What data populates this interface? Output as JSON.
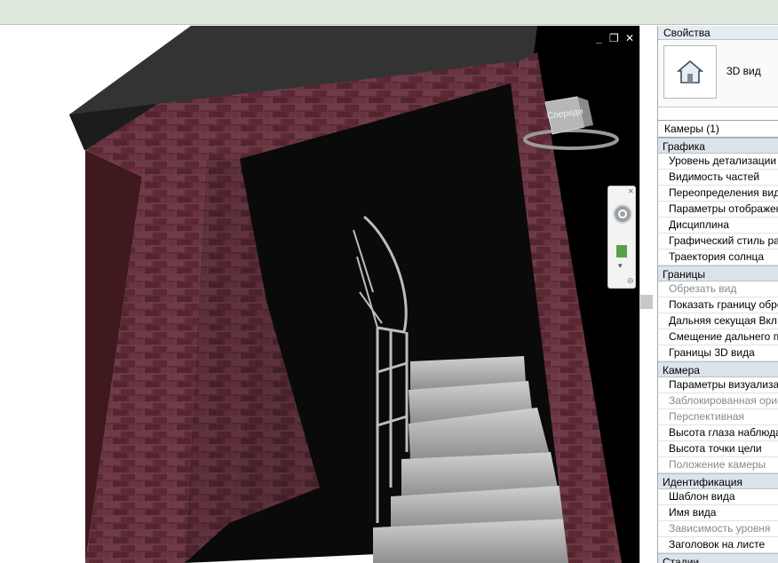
{
  "viewport": {
    "controls": {
      "minimize": "_",
      "restore": "❐",
      "close": "✕"
    },
    "viewcube_face": "Спереди",
    "navbar_icons": [
      "close-icon",
      "steering-wheel-icon",
      "zoom-icon",
      "chevron-down-icon",
      "options-icon"
    ]
  },
  "properties": {
    "title": "Свойства",
    "type_name": "3D вид",
    "type_icon": "house-icon",
    "selector": "Камеры (1)",
    "groups": [
      {
        "name": "Графика",
        "rows": [
          {
            "label": "Уровень детализации",
            "disabled": false
          },
          {
            "label": "Видимость частей",
            "disabled": false
          },
          {
            "label": "Переопределения видимости",
            "disabled": false
          },
          {
            "label": "Параметры отображения",
            "disabled": false
          },
          {
            "label": "Дисциплина",
            "disabled": false
          },
          {
            "label": "Графический стиль раз",
            "disabled": false
          },
          {
            "label": "Траектория солнца",
            "disabled": false
          }
        ]
      },
      {
        "name": "Границы",
        "rows": [
          {
            "label": "Обрезать вид",
            "disabled": true
          },
          {
            "label": "Показать границу обрезки",
            "disabled": false
          },
          {
            "label": "Дальняя секущая Вкл",
            "disabled": false
          },
          {
            "label": "Смещение дальнего п",
            "disabled": false
          },
          {
            "label": "Границы 3D вида",
            "disabled": false
          }
        ]
      },
      {
        "name": "Камера",
        "rows": [
          {
            "label": "Параметры визуализации",
            "disabled": false
          },
          {
            "label": "Заблокированная ориентация",
            "disabled": true
          },
          {
            "label": "Перспективная",
            "disabled": true
          },
          {
            "label": "Высота глаза наблюдателя",
            "disabled": false
          },
          {
            "label": "Высота точки цели",
            "disabled": false
          },
          {
            "label": "Положение камеры",
            "disabled": true
          }
        ]
      },
      {
        "name": "Идентификация",
        "rows": [
          {
            "label": "Шаблон вида",
            "disabled": false
          },
          {
            "label": "Имя вида",
            "disabled": false
          },
          {
            "label": "Зависимость уровня",
            "disabled": true
          },
          {
            "label": "Заголовок на листе",
            "disabled": false
          }
        ]
      },
      {
        "name": "Стадии",
        "rows": []
      }
    ]
  },
  "colors": {
    "brick": "#5e2a36",
    "roof": "#2f2f2f",
    "panel_group_bg": "#dde3ea",
    "disabled_text": "#8a8a8a"
  }
}
